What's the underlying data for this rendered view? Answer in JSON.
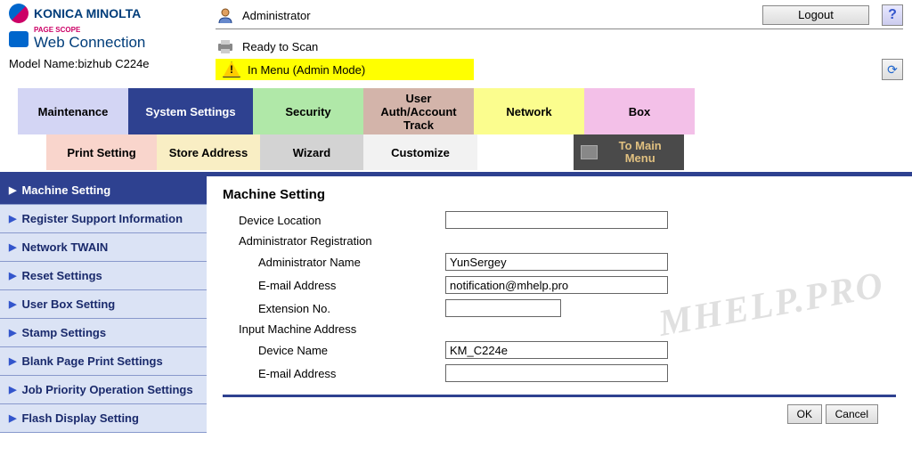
{
  "brand": "KONICA MINOLTA",
  "ps_small": "PAGE SCOPE",
  "ps_large": "Web Connection",
  "model_label": "Model Name:",
  "model_value": "bizhub C224e",
  "header": {
    "user": "Administrator",
    "logout": "Logout",
    "help": "?",
    "scan_status": "Ready to Scan",
    "mode_status": "In Menu (Admin Mode)"
  },
  "tabs1": {
    "maintenance": "Maintenance",
    "system": "System Settings",
    "security": "Security",
    "user": "User Auth/Account Track",
    "network": "Network",
    "box": "Box"
  },
  "tabs2": {
    "print": "Print Setting",
    "store": "Store Address",
    "wizard": "Wizard",
    "customize": "Customize",
    "main": "To Main Menu"
  },
  "sidebar": [
    "Machine Setting",
    "Register Support Information",
    "Network TWAIN",
    "Reset Settings",
    "User Box Setting",
    "Stamp Settings",
    "Blank Page Print Settings",
    "Job Priority Operation Settings",
    "Flash Display Setting"
  ],
  "form": {
    "title": "Machine Setting",
    "device_location_label": "Device Location",
    "device_location": "",
    "admin_reg_label": "Administrator Registration",
    "admin_name_label": "Administrator Name",
    "admin_name": "YunSergey",
    "email_label": "E-mail Address",
    "email": "notification@mhelp.pro",
    "ext_label": "Extension No.",
    "ext": "",
    "input_machine_label": "Input Machine Address",
    "device_name_label": "Device Name",
    "device_name": "KM_C224e",
    "email2_label": "E-mail Address",
    "email2": "",
    "ok": "OK",
    "cancel": "Cancel"
  },
  "watermark": "MHELP.PRO"
}
